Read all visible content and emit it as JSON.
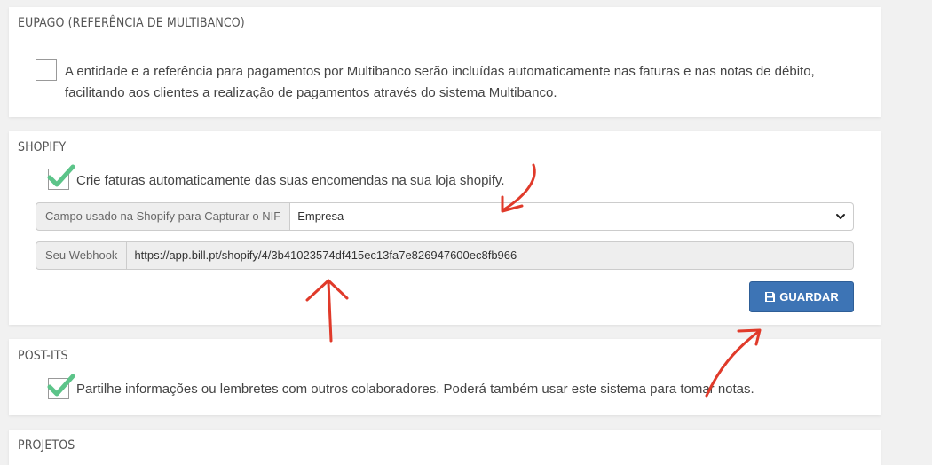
{
  "eupago": {
    "title": "EUPAGO (REFERÊNCIA DE MULTIBANCO)",
    "line1": "A entidade e a referência para pagamentos por Multibanco serão incluídas automaticamente nas faturas e nas notas de débito,",
    "line2": "facilitando aos clientes a realização de pagamentos através do sistema Multibanco.",
    "checked": false
  },
  "shopify": {
    "title": "SHOPIFY",
    "checkbox_label": "Crie faturas automaticamente das suas encomendas na sua loja shopify.",
    "checked": true,
    "nif_label": "Campo usado na Shopify para Capturar o NIF",
    "nif_value": "Empresa",
    "webhook_label": "Seu Webhook",
    "webhook_value": "https://app.bill.pt/shopify/4/3b41023574df415ec13fa7e826947600ec8fb966",
    "save_label": "GUARDAR"
  },
  "postits": {
    "title": "POST-ITS",
    "checkbox_label": "Partilhe informações ou lembretes com outros colaboradores. Poderá também usar este sistema para tomar notas.",
    "checked": true
  },
  "projetos": {
    "title": "PROJETOS"
  },
  "colors": {
    "check": "#5cc489",
    "button": "#3d74b5",
    "annotation": "#e03a2a"
  },
  "icons": [
    "checkmark-icon",
    "chevron-down-icon",
    "save-icon"
  ]
}
